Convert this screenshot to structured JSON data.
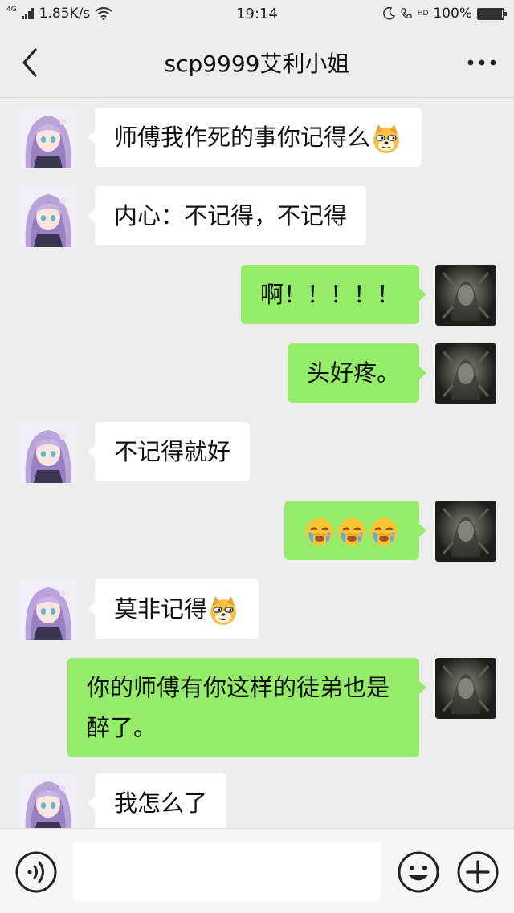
{
  "status_bar": {
    "network": "4G",
    "speed": "1.85K/s",
    "time": "19:14",
    "hd_label": "HD",
    "battery": "100%"
  },
  "header": {
    "title": "scp9999艾利小姐",
    "back_icon": "chevron-left-icon",
    "more_icon": "more-dots-icon"
  },
  "colors": {
    "background": "#ededed",
    "bubble_self": "#95ec69",
    "bubble_other": "#ffffff"
  },
  "messages": [
    {
      "side": "left",
      "text": "师傅我作死的事你记得么",
      "emoji": "doge-icon"
    },
    {
      "side": "left",
      "text": "内心：不记得，不记得"
    },
    {
      "side": "right",
      "text": "啊！！！！！"
    },
    {
      "side": "right",
      "text": "头好疼。"
    },
    {
      "side": "left",
      "text": "不记得就好"
    },
    {
      "side": "right",
      "text": "",
      "emoji": "facepalm-cry-icon x3"
    },
    {
      "side": "left",
      "text": "莫非记得",
      "emoji": "doge-icon"
    },
    {
      "side": "right",
      "text": "你的师傅有你这样的徒弟也是醉了。"
    },
    {
      "side": "left",
      "text": "我怎么了"
    }
  ],
  "input_bar": {
    "value": "",
    "voice_icon": "voice-icon",
    "emoji_icon": "smiley-icon",
    "plus_icon": "plus-icon"
  }
}
